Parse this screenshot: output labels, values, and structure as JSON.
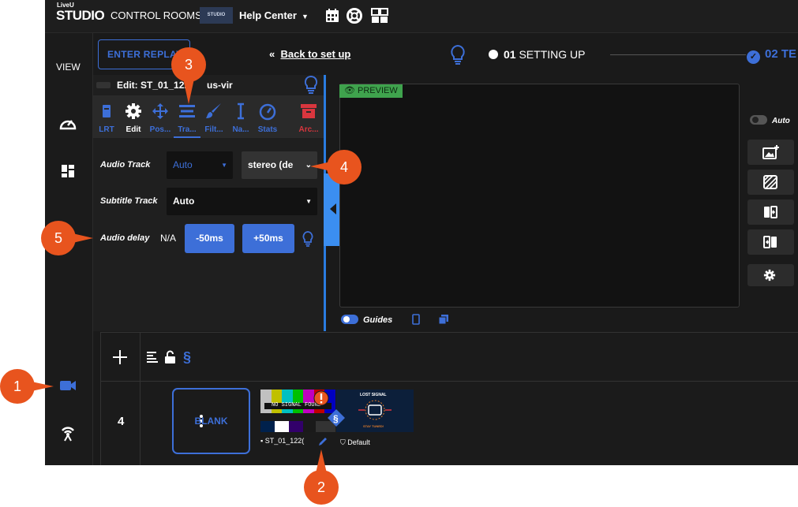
{
  "topbar": {
    "logo_top": "LiveU",
    "logo_main": "STUDIO",
    "control_rooms": "CONTROL ROOMS",
    "studio_thumb": "STUDIO",
    "help_center": "Help Center",
    "icons": [
      "calendar-icon",
      "lifebuoy-icon",
      "layout-icon"
    ]
  },
  "leftnav": {
    "view_label": "VIEW",
    "items": [
      "speedometer-icon",
      "dashboard-grid-icon",
      "camera-icon",
      "antenna-icon"
    ]
  },
  "header": {
    "replay_button": "ENTER REPLAY",
    "back_link_arrows": "«",
    "back_link": "Back to set up",
    "step1_number": "01",
    "step1_label": "SETTING UP",
    "step2_number": "02",
    "step2_label": "TE"
  },
  "edit_panel": {
    "title": "Edit: ST_01_122",
    "title_suffix": "us-vir",
    "tools": [
      {
        "label": "LRT",
        "icon": "lrt-icon"
      },
      {
        "label": "Edit",
        "icon": "gear-icon"
      },
      {
        "label": "Pos...",
        "icon": "move-icon"
      },
      {
        "label": "Tra...",
        "icon": "tracks-icon"
      },
      {
        "label": "Filt...",
        "icon": "brush-icon"
      },
      {
        "label": "Na...",
        "icon": "text-cursor-icon"
      },
      {
        "label": "Stats",
        "icon": "gauge-icon"
      },
      {
        "label": "Arc...",
        "icon": "archive-icon"
      }
    ],
    "audio_track_label": "Audio Track",
    "audio_track_value": "Auto",
    "audio_channel_value": "stereo (de",
    "subtitle_track_label": "Subtitle Track",
    "subtitle_track_value": "Auto",
    "audio_delay_label": "Audio delay",
    "audio_delay_value": "N/A",
    "minus_button": "-50ms",
    "plus_button": "+50ms"
  },
  "preview": {
    "badge": "PREVIEW",
    "guides_label": "Guides"
  },
  "side_controls": {
    "auto_label": "Auto",
    "buttons": [
      "add-image-icon",
      "stripes-icon",
      "swap-in-icon",
      "swap-out-icon",
      "gear-icon"
    ]
  },
  "timeline": {
    "row_number": "4",
    "blank_label": "BLANK",
    "thumb_text": "NO SIGNAL FOUND",
    "lost_signal_text": "LOST SIGNAL",
    "stay_tuned_text": "STAY TUNED!",
    "source_label": "ST_01_122(",
    "default_label": "Default"
  },
  "callouts": [
    "1",
    "2",
    "3",
    "4",
    "5"
  ],
  "colors": {
    "accent": "#3d6fd8",
    "callout": "#e8541e",
    "preview_badge": "#3fa34d"
  }
}
